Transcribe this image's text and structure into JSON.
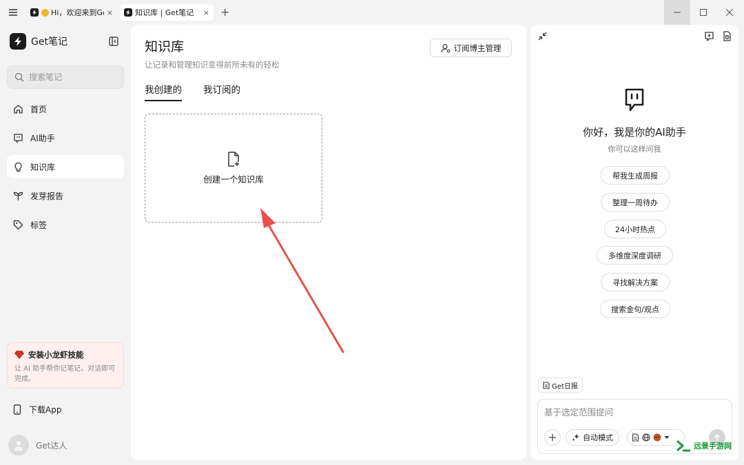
{
  "titlebar": {
    "tabs": [
      {
        "title": "Hi，欢迎来到Ge",
        "close": "×"
      },
      {
        "title": "知识库 | Get笔记",
        "close": "×"
      }
    ],
    "new_tab": "+"
  },
  "sidebar": {
    "app_name": "Get笔记",
    "search_placeholder": "搜索笔记",
    "items": [
      {
        "label": "首页",
        "icon": "home-icon"
      },
      {
        "label": "AI助手",
        "icon": "ai-chat-icon"
      },
      {
        "label": "知识库",
        "icon": "lightbulb-icon",
        "active": true
      },
      {
        "label": "发芽报告",
        "icon": "sprout-icon"
      },
      {
        "label": "标签",
        "icon": "tag-icon"
      }
    ],
    "promo": {
      "title": "安装小龙虾技能",
      "desc": "让 AI 助手帮你记笔记，对话即可完成。"
    },
    "download_label": "下载App",
    "user_name": "Get达人"
  },
  "main": {
    "title": "知识库",
    "subtitle": "让记录和管理知识变得前所未有的轻松",
    "subscribe_button": "订阅博主管理",
    "tabs": [
      {
        "label": "我创建的",
        "active": true
      },
      {
        "label": "我订阅的",
        "active": false
      }
    ],
    "create_card_label": "创建一个知识库"
  },
  "ai_panel": {
    "greeting": "你好，我是你的AI助手",
    "hint": "你可以这样问我",
    "suggestions": [
      "帮我生成周报",
      "整理一周待办",
      "24小时热点",
      "多维度深度调研",
      "寻找解决方案",
      "搜索金句/观点"
    ],
    "daily_label": "Get日报",
    "input_placeholder": "基于选定范围提问",
    "mode_label": "自动模式"
  },
  "watermark": "远景手游网",
  "colors": {
    "accent": "#1a1a1a",
    "arrow": "#e8504d",
    "promo_bg": "#fdf0ee",
    "watermark": "#1e9a3e"
  }
}
